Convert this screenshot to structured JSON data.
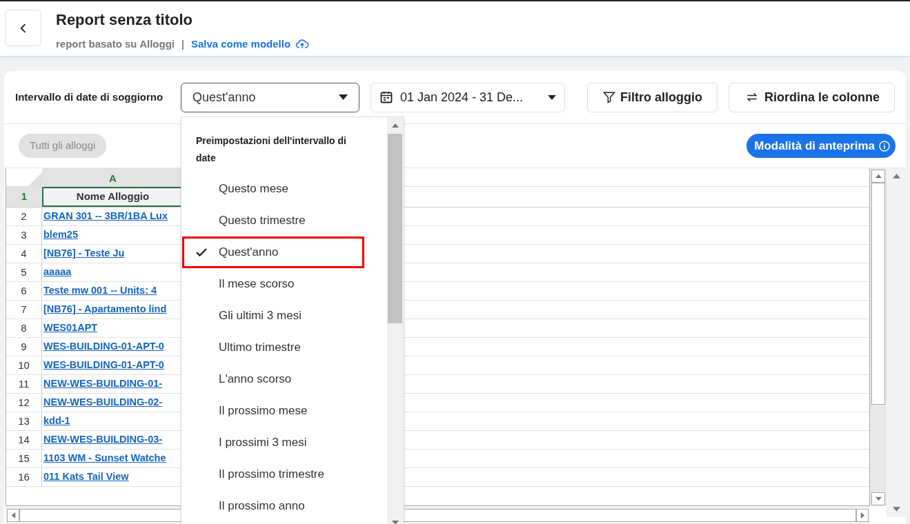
{
  "header": {
    "title": "Report senza titolo",
    "subtitle": "report basato su Alloggi",
    "separator": "|",
    "save_link": "Salva come modello"
  },
  "toolbar": {
    "label": "Intervallo di date di soggiorno",
    "preset_select": {
      "value": "Quest'anno",
      "expanded": true
    },
    "date_range": "01 Jan 2024 - 31 De...",
    "filter_button": "Filtro alloggio",
    "reorder_button": "Riordina le colonne"
  },
  "filter_chip": {
    "label": "Tutti gli alloggi",
    "disabled": true
  },
  "preview_badge": "Modalità di anteprima",
  "dropdown": {
    "heading": "Preimpostazioni dell'intervallo di date",
    "items": [
      {
        "label": "Questo mese",
        "selected": false
      },
      {
        "label": "Questo trimestre",
        "selected": false
      },
      {
        "label": "Quest'anno",
        "selected": true
      },
      {
        "label": "Il mese scorso",
        "selected": false
      },
      {
        "label": "Gli ultimi 3 mesi",
        "selected": false
      },
      {
        "label": "Ultimo trimestre",
        "selected": false
      },
      {
        "label": "L'anno scorso",
        "selected": false
      },
      {
        "label": "Il prossimo mese",
        "selected": false
      },
      {
        "label": "I prossimi 3 mesi",
        "selected": false
      },
      {
        "label": "Il prossimo trimestre",
        "selected": false
      },
      {
        "label": "Il prossimo anno",
        "selected": false
      }
    ]
  },
  "sheet": {
    "column_letter": "A",
    "header_row_number": "1",
    "header": "Nome Alloggio",
    "rows": [
      {
        "number": "2",
        "cell": "GRAN 301 -- 3BR/1BA Lux"
      },
      {
        "number": "3",
        "cell": "blem25"
      },
      {
        "number": "4",
        "cell": "[NB76] - Teste Ju"
      },
      {
        "number": "5",
        "cell": "aaaaa"
      },
      {
        "number": "6",
        "cell": "Teste mw 001 -- Units: 4"
      },
      {
        "number": "7",
        "cell": "[NB76] - Apartamento lind"
      },
      {
        "number": "8",
        "cell": "WES01APT"
      },
      {
        "number": "9",
        "cell": "WES-BUILDING-01-APT-0"
      },
      {
        "number": "10",
        "cell": "WES-BUILDING-01-APT-0"
      },
      {
        "number": "11",
        "cell": "NEW-WES-BUILDING-01-"
      },
      {
        "number": "12",
        "cell": "NEW-WES-BUILDING-02-"
      },
      {
        "number": "13",
        "cell": "kdd-1"
      },
      {
        "number": "14",
        "cell": "NEW-WES-BUILDING-03-"
      },
      {
        "number": "15",
        "cell": "1103 WM - Sunset Watche"
      },
      {
        "number": "16",
        "cell": "011 Kats Tail View"
      }
    ]
  }
}
